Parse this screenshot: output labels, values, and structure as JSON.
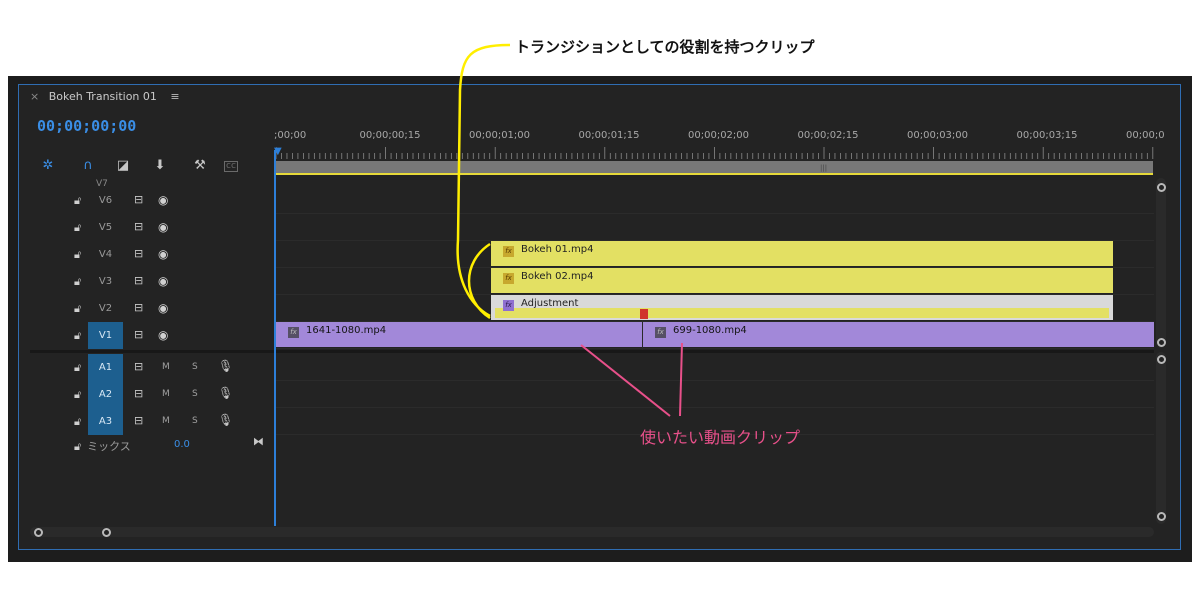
{
  "annotations": {
    "top_label": "トランジションとしての役割を持つクリップ",
    "bottom_label": "使いたい動画クリップ"
  },
  "panel": {
    "close_glyph": "×",
    "sequence_name": "Bokeh Transition 01",
    "menu_glyph": "≡",
    "timecode": "00;00;00;00"
  },
  "toolbar": {
    "icons": [
      "snap-icon",
      "magnet-icon",
      "linked-selection-icon",
      "marker-icon",
      "wrench-icon",
      "captions-icon"
    ]
  },
  "ruler": {
    "labels": [
      ";00;00",
      "00;00;00;15",
      "00;00;01;00",
      "00;00;01;15",
      "00;00;02;00",
      "00;00;02;15",
      "00;00;03;00",
      "00;00;03;15",
      "00;00;0"
    ]
  },
  "tracks": {
    "partial_top": "V7",
    "video": [
      {
        "name": "V6",
        "active": false
      },
      {
        "name": "V5",
        "active": false
      },
      {
        "name": "V4",
        "active": false
      },
      {
        "name": "V3",
        "active": false
      },
      {
        "name": "V2",
        "active": false
      },
      {
        "name": "V1",
        "active": true
      }
    ],
    "audio": [
      {
        "name": "A1",
        "m": "M",
        "s": "S"
      },
      {
        "name": "A2",
        "m": "M",
        "s": "S"
      },
      {
        "name": "A3",
        "m": "M",
        "s": "S"
      }
    ],
    "mix": {
      "label": "ミックス",
      "value": "0.0"
    }
  },
  "clips": {
    "bokeh1": "Bokeh 01.mp4",
    "bokeh2": "Bokeh 02.mp4",
    "adjustment": "Adjustment",
    "clip_a": "1641-1080.mp4",
    "clip_b": "699-1080.mp4",
    "fx": "fx"
  },
  "colors": {
    "accent_blue": "#2d7fd8",
    "clip_yellow": "#e3e063",
    "clip_purple": "#a288d9",
    "annotation_pink": "#e8508a",
    "annotation_yellow": "#ffee00"
  }
}
